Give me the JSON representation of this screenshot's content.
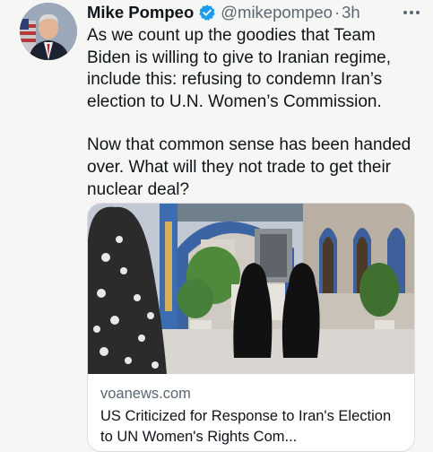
{
  "tweet": {
    "author_name": "Mike Pompeo",
    "handle": "@mikepompeo",
    "separator": "·",
    "time": "3h",
    "paragraphs": [
      "As we count up the goodies that Team Biden is willing to give to Iranian regime, include this: refusing to condemn Iran’s election to U.N. Women’s Commission.",
      "Now that common sense has been handed over. What will they not trade to get their nuclear deal?"
    ]
  },
  "icons": {
    "verified": "verified-badge-icon",
    "more": "more-options-icon"
  },
  "link_card": {
    "domain": "voanews.com",
    "title": "US Criticized for Response to Iran's Election to UN Women's Rights Com..."
  },
  "colors": {
    "verified_blue": "#1d9bf0",
    "secondary_text": "#5b6670",
    "primary_text": "#0f1419"
  }
}
